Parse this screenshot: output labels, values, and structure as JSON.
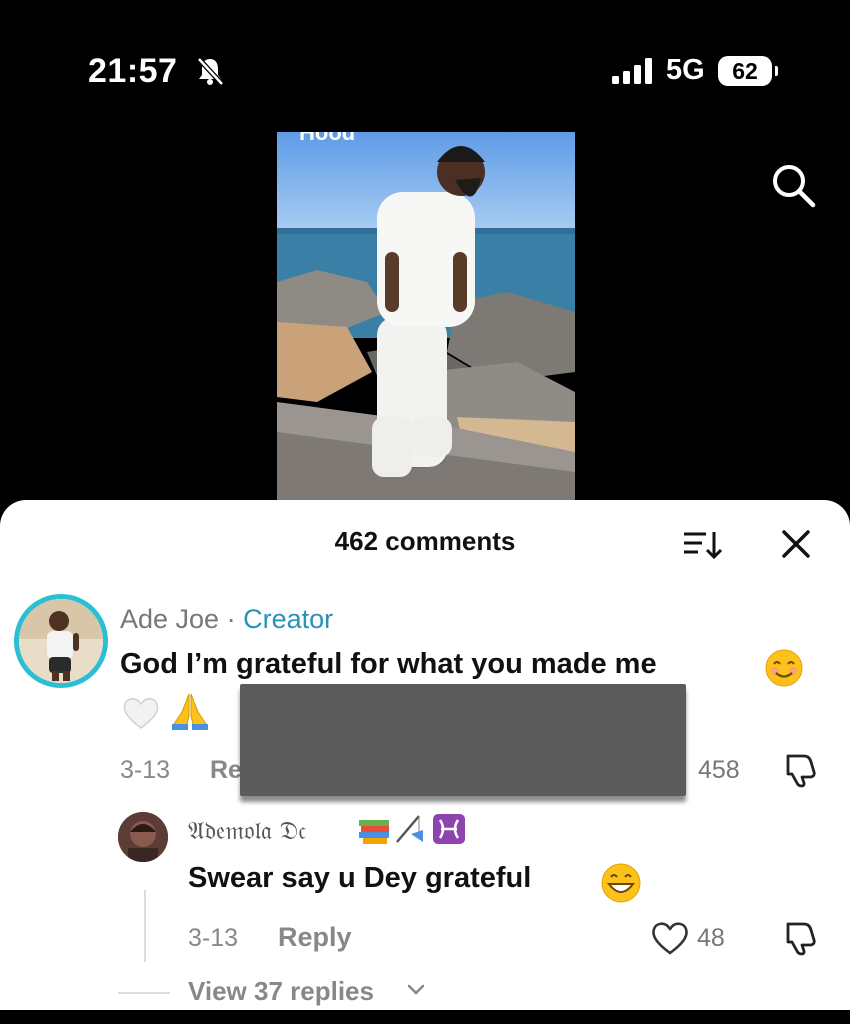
{
  "status_bar": {
    "time": "21:57",
    "network": "5G",
    "battery": "62"
  },
  "video": {
    "caption_fragment": "Hood"
  },
  "comments_panel": {
    "title": "462 comments",
    "comments": [
      {
        "author": "Ade Joe",
        "separator": " · ",
        "badge": "Creator",
        "text": "God I’m grateful for what you made me",
        "date": "3-13",
        "reply_label": "Re",
        "likes": "458"
      },
      {
        "author": "𝔄𝔡𝔢𝔪𝔬𝔩𝔞 𝔇𝔠",
        "text": "Swear say u Dey grateful",
        "date": "3-13",
        "reply_label": "Reply",
        "likes": "48"
      }
    ],
    "view_replies": "View 37 replies"
  },
  "colors": {
    "accent": "#2a92b8",
    "avatar_ring": "#2bbfd4",
    "redaction": "#5b5b5b"
  },
  "icons": [
    "silent-bell-icon",
    "signal-icon",
    "search-icon",
    "sort-icon",
    "close-icon",
    "heart-icon",
    "dislike-icon",
    "chevron-down-icon"
  ]
}
